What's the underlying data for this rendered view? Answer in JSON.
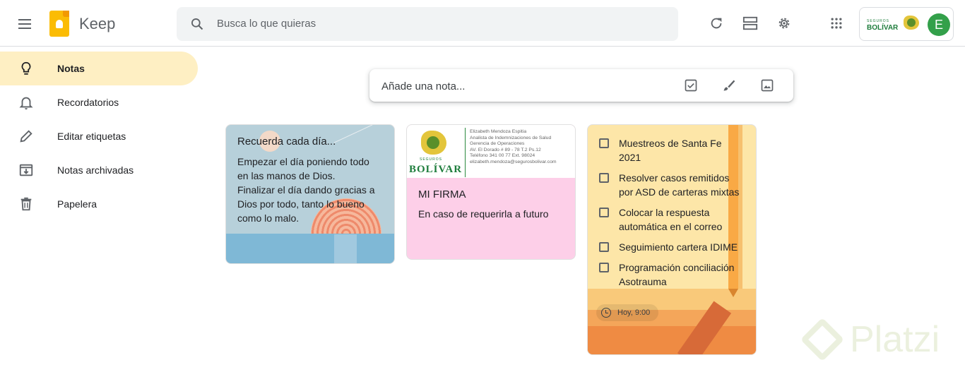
{
  "app": {
    "name": "Keep"
  },
  "search": {
    "placeholder": "Busca lo que quieras"
  },
  "account": {
    "brand_top": "SEGUROS",
    "brand": "BOLÍVAR",
    "avatar_letter": "E",
    "avatar_color": "#33a04a"
  },
  "sidebar": {
    "items": [
      {
        "label": "Notas",
        "icon": "lightbulb-icon",
        "active": true
      },
      {
        "label": "Recordatorios",
        "icon": "bell-icon"
      },
      {
        "label": "Editar etiquetas",
        "icon": "pencil-icon"
      },
      {
        "label": "Notas archivadas",
        "icon": "archive-icon"
      },
      {
        "label": "Papelera",
        "icon": "trash-icon"
      }
    ]
  },
  "take_note": {
    "placeholder": "Añade una nota..."
  },
  "notes": [
    {
      "title": "Recuerda cada día...",
      "body": [
        "Empezar el día poniendo todo",
        "en las manos de Dios.",
        "Finalizar el día dando gracias a",
        "Dios por todo, tanto lo bueno",
        "como lo malo."
      ],
      "background": "sunset-sea"
    },
    {
      "title": "MI FIRMA",
      "body": "En caso de requerirla a futuro",
      "color": "#fdcfe8",
      "signature": {
        "brand_top": "SEGUROS",
        "brand": "BOLÍVAR",
        "lines": [
          "Elizabeth Mendoza Espitia",
          "Analista de Indemnizaciones de Salud",
          "Gerencia de Operaciones",
          "AV. El Dorado # 89 - 78 T.2 Ps.12",
          "Teléfono 341 00 77 Ext. 98024",
          "elizabeth.mendoza@segurosbolivar.com"
        ]
      }
    },
    {
      "checklist": [
        [
          "Muestreos de Santa Fe",
          "2021"
        ],
        [
          "Resolver casos remitidos",
          "por ASD de carteras mixtas"
        ],
        [
          "Colocar la respuesta",
          "automática en el correo"
        ],
        [
          "Seguimiento cartera IDIME"
        ],
        [
          "Programación conciliación",
          "Asotrauma"
        ]
      ],
      "reminder": "Hoy, 9:00",
      "background": "desert-pencil"
    }
  ],
  "watermark": {
    "text": "Platzi"
  }
}
